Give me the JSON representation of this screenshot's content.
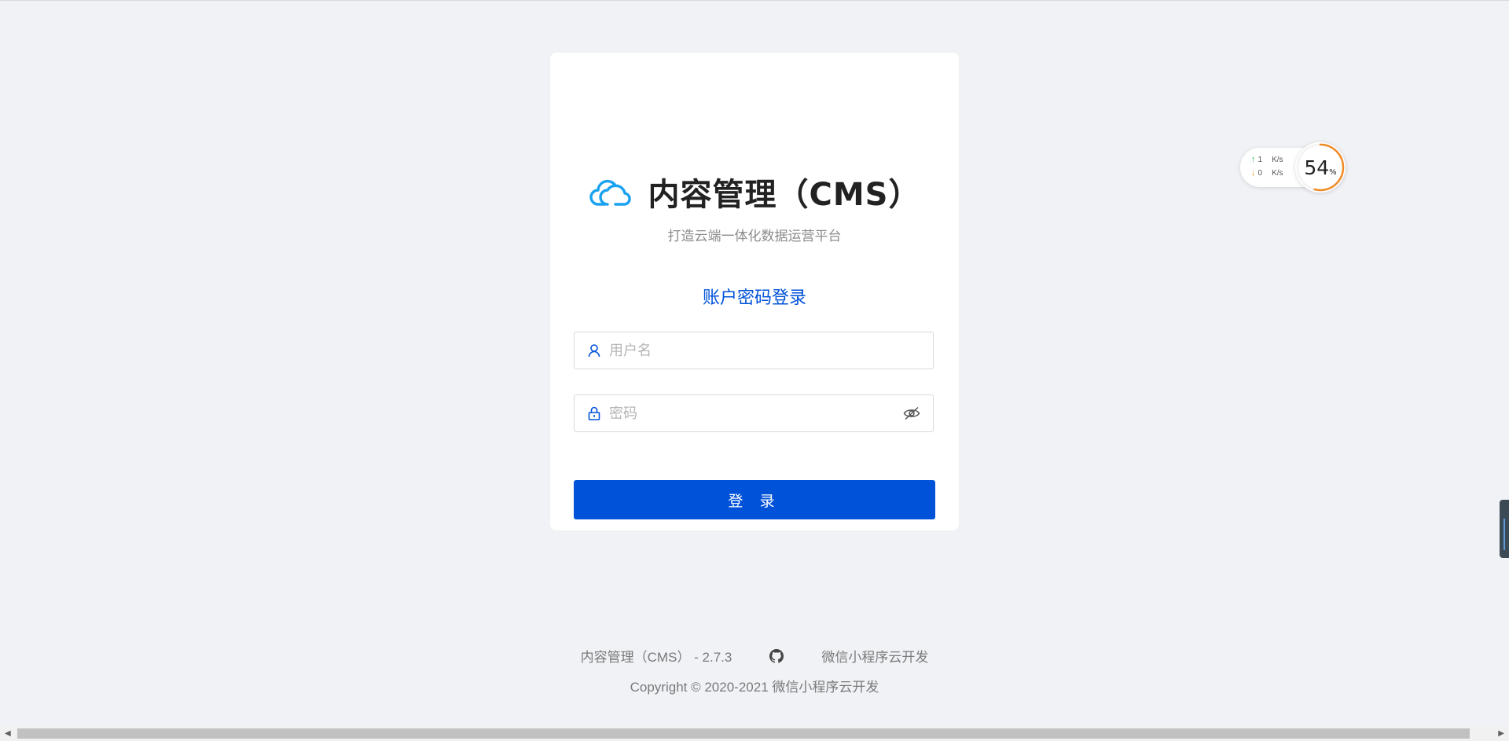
{
  "brand": {
    "title": "内容管理（CMS）",
    "subtitle": "打造云端一体化数据运营平台",
    "logo_icon": "cloud-icon",
    "logo_color": "#1aa2f0"
  },
  "login": {
    "heading": "账户密码登录",
    "username_placeholder": "用户名",
    "password_placeholder": "密码",
    "submit_label": "登 录",
    "accent": "#0052d9"
  },
  "footer": {
    "version_text": "内容管理（CMS） - 2.7.3",
    "github_icon": "github-icon",
    "link_text": "微信小程序云开发",
    "copyright": "Copyright © 2020-2021 微信小程序云开发"
  },
  "netmon": {
    "upload": "1",
    "download": "0",
    "unit": "K/s",
    "percent": "54",
    "percent_sign": "%",
    "percent_value": 54
  }
}
